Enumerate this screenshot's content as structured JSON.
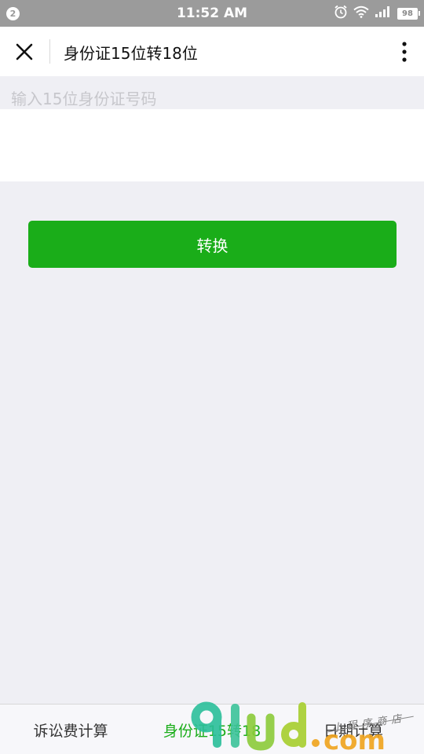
{
  "status_bar": {
    "notification_count": "2",
    "time": "11:52 AM",
    "battery": "98",
    "icons": [
      "alarm-icon",
      "wifi-icon",
      "signal-icon",
      "battery-icon"
    ]
  },
  "nav": {
    "title": "身份证15位转18位",
    "close_icon": "close-icon",
    "more_icon": "more-vertical-icon"
  },
  "form": {
    "input_label": "输入15位身份证号码",
    "input_value": "",
    "convert_label": "转换"
  },
  "tabs": [
    {
      "label": "诉讼费计算",
      "active": false
    },
    {
      "label": "身份证15转18",
      "active": true
    },
    {
      "label": "日期计算",
      "active": false
    }
  ],
  "watermark": {
    "logo_text": "91ud.com",
    "tagline": "小程序商店"
  },
  "colors": {
    "accent": "#1aad19",
    "status_bar": "#9b9b9b",
    "background": "#efeff4",
    "placeholder": "#c7c7cc"
  }
}
